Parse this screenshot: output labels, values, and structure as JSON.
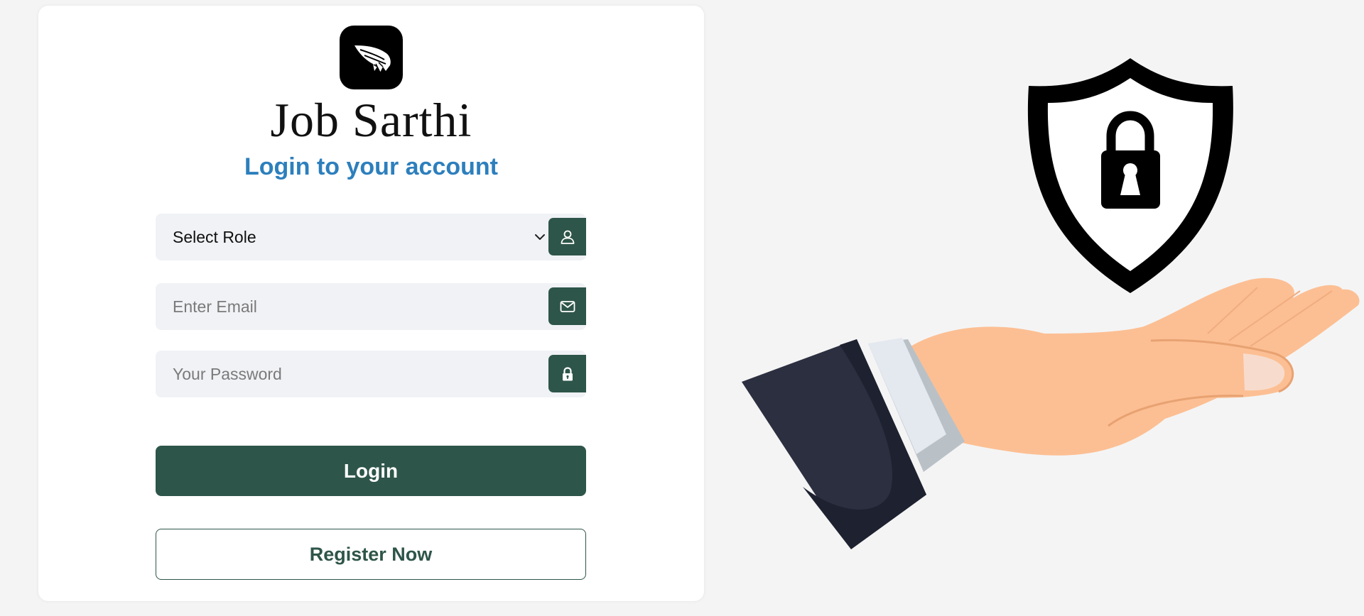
{
  "brand": {
    "name": "Job Sarthi",
    "logo_icon": "wing-icon"
  },
  "login_form": {
    "subtitle": "Login to your account",
    "role_select": {
      "selected": "Select Role",
      "icon": "user-icon"
    },
    "email": {
      "placeholder": "Enter Email",
      "value": "",
      "icon": "mail-icon"
    },
    "password": {
      "placeholder": "Your Password",
      "value": "",
      "icon": "lock-icon"
    },
    "login_label": "Login",
    "register_label": "Register Now"
  },
  "illustration": {
    "icons": [
      "shield-lock-icon",
      "open-hand-icon"
    ]
  },
  "colors": {
    "primary": "#2e5549",
    "subtitle": "#2d7fbd",
    "field_bg": "#f0f2f5",
    "page_bg": "#f4f4f4",
    "skin": "#fcbf93",
    "sleeve": "#2c2f40"
  }
}
